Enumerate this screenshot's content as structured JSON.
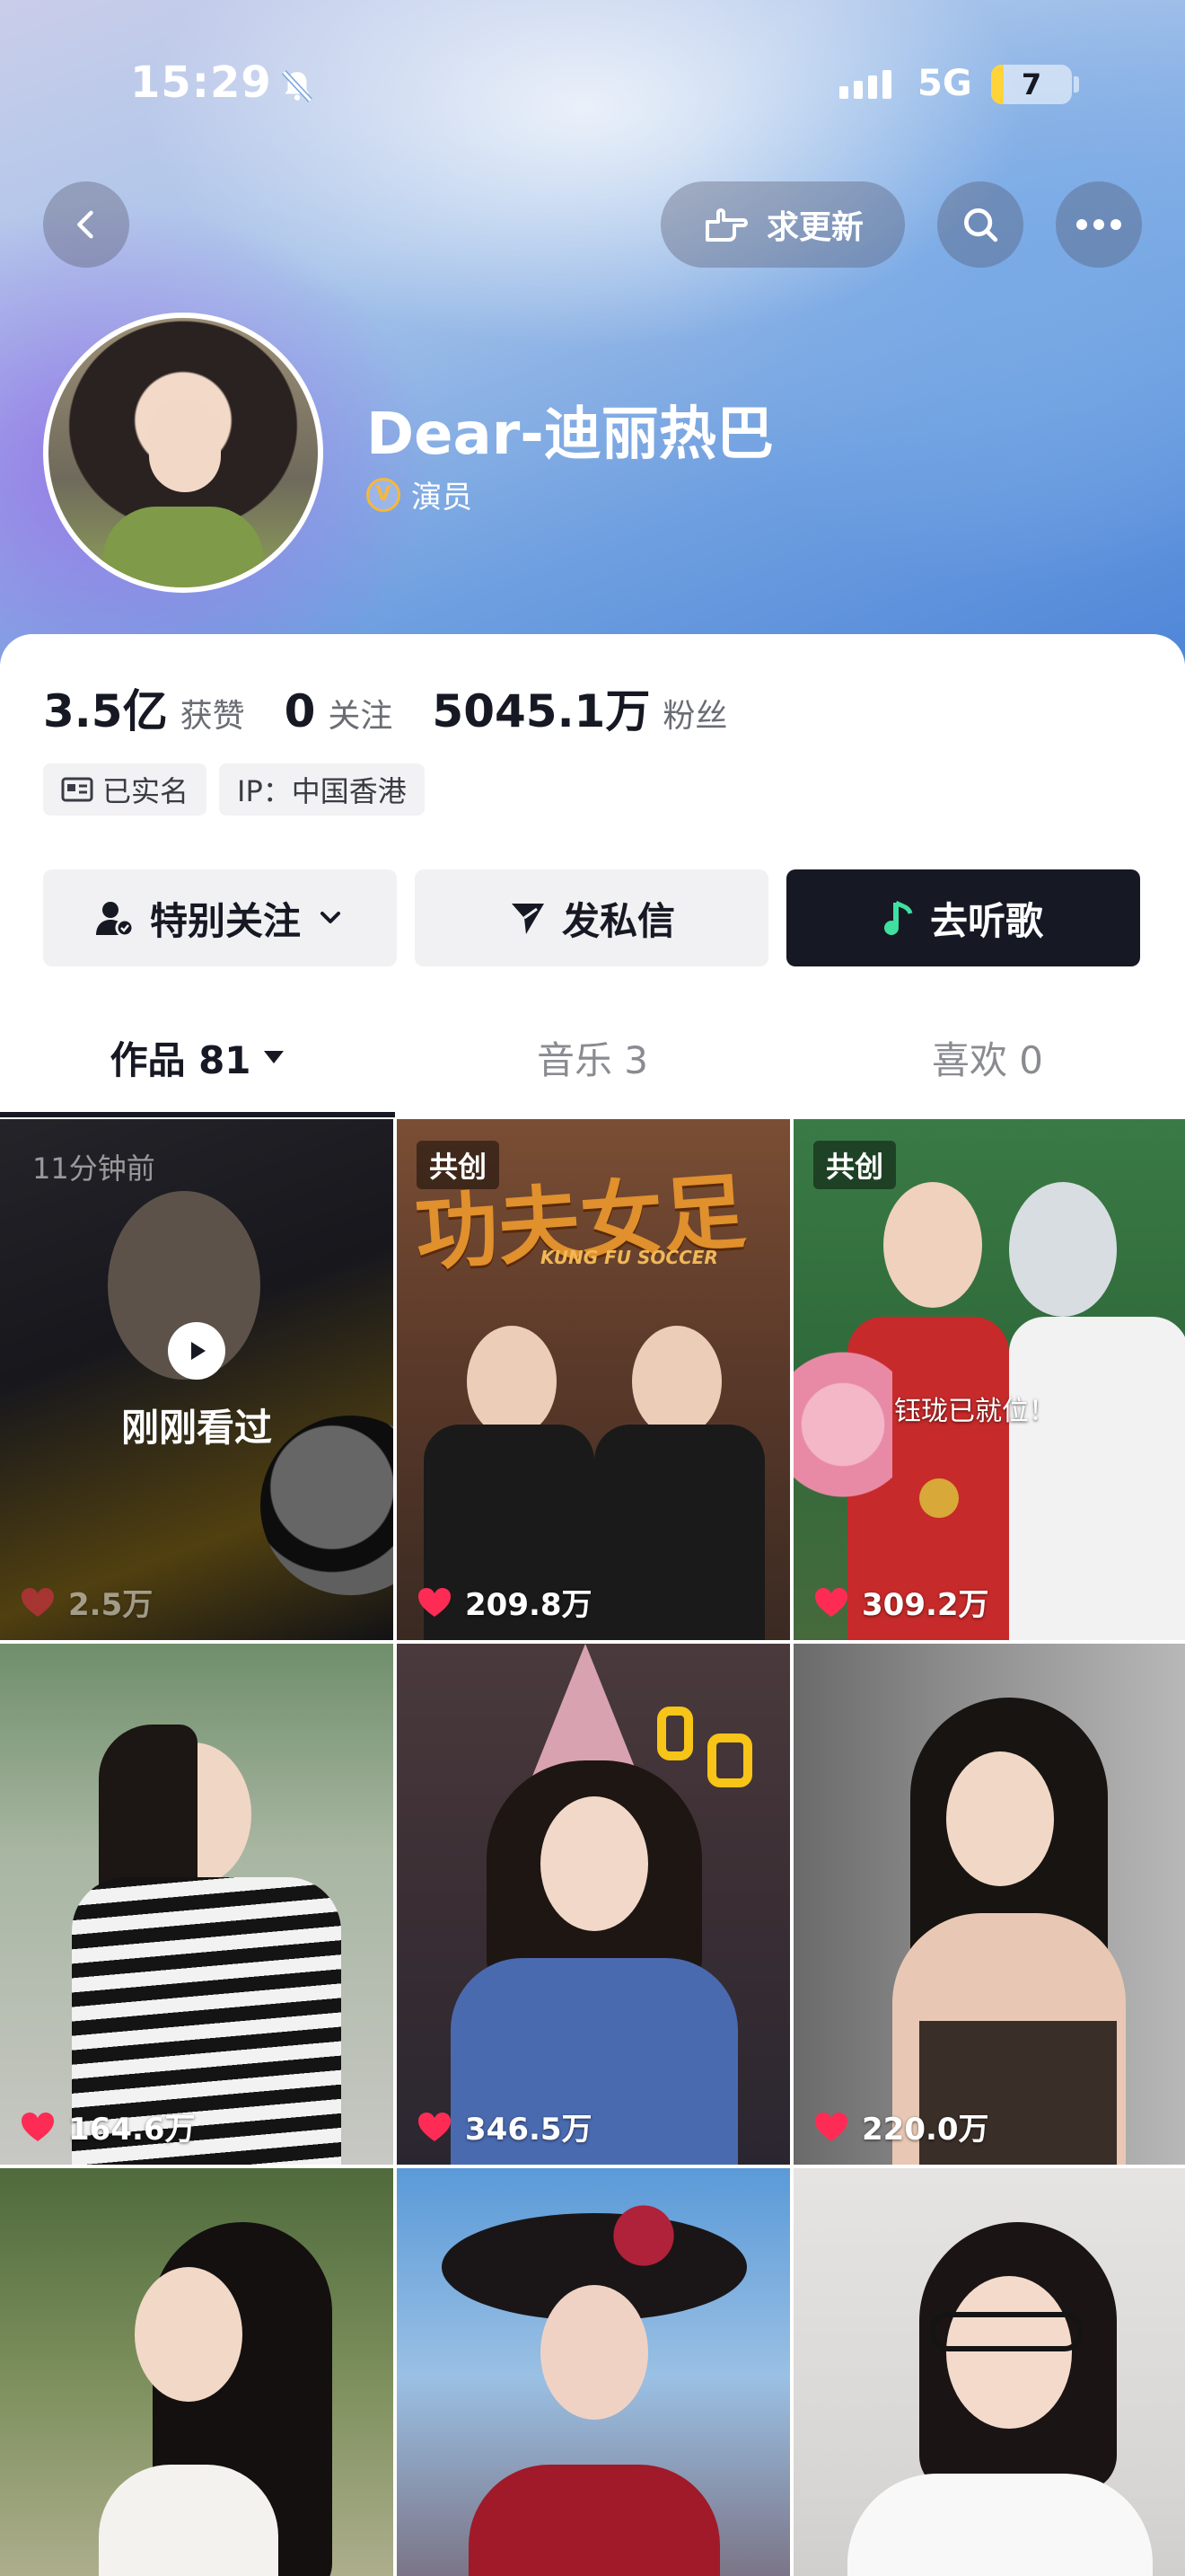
{
  "status_bar": {
    "time": "15:29",
    "network": "5G",
    "battery": "7"
  },
  "header": {
    "update_label": "求更新",
    "name": "Dear-迪丽热巴",
    "role": "演员",
    "verified_icon": "v-badge-icon"
  },
  "stats": [
    {
      "value": "3.5亿",
      "label": "获赞"
    },
    {
      "value": "0",
      "label": "关注"
    },
    {
      "value": "5045.1万",
      "label": "粉丝"
    }
  ],
  "tags": {
    "verified_name": "已实名",
    "ip": "IP：中国香港"
  },
  "actions": {
    "special_follow": "特别关注",
    "message": "发私信",
    "listen": "去听歌"
  },
  "tabs": [
    {
      "label": "作品 81"
    },
    {
      "label": "音乐 3"
    },
    {
      "label": "喜欢 0"
    }
  ],
  "videos": [
    {
      "likes": "2.5万",
      "time_ago": "11分钟前",
      "viewed_label": "刚刚看过"
    },
    {
      "likes": "209.8万",
      "badge": "共创",
      "overlay_title": "功夫女足",
      "overlay_sub": "KUNG FU SOCCER"
    },
    {
      "likes": "309.2万",
      "badge": "共创",
      "caption": "钰珑已就位！"
    },
    {
      "likes": "164.6万"
    },
    {
      "likes": "346.5万"
    },
    {
      "likes": "220.0万"
    },
    {
      "likes": ""
    },
    {
      "likes": ""
    },
    {
      "likes": ""
    }
  ],
  "colors": {
    "accent_like": "#fe2c55",
    "dark_button": "#161823",
    "music_icon": "#3fe0a0"
  }
}
